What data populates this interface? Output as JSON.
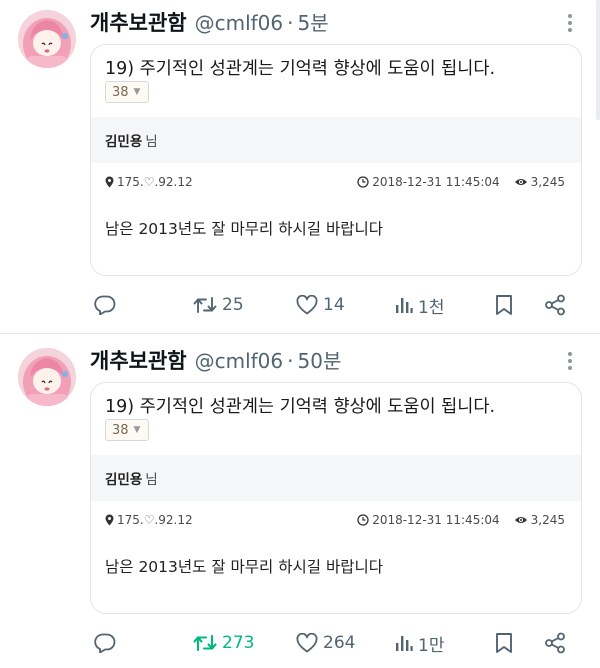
{
  "tweets": [
    {
      "author_name": "개추보관함",
      "handle": "@cmlf06",
      "separator": "·",
      "time": "5분",
      "card": {
        "title": "19) 주기적인 성관계는 기억력 향상에 도움이 됩니다.",
        "select_value": "38",
        "post_author": "김민용",
        "post_author_suffix": "님",
        "ip": "175.♡.92.12",
        "datetime": "2018-12-31 11:45:04",
        "views": "3,245",
        "body": "남은 2013년도 잘 마무리 하시길 바랍니다"
      },
      "actions": {
        "retweets": "25",
        "likes": "14",
        "views": "1천"
      },
      "retweeted": false
    },
    {
      "author_name": "개추보관함",
      "handle": "@cmlf06",
      "separator": "·",
      "time": "50분",
      "card": {
        "title": "19) 주기적인 성관계는 기억력 향상에 도움이 됩니다.",
        "select_value": "38",
        "post_author": "김민용",
        "post_author_suffix": "님",
        "ip": "175.♡.92.12",
        "datetime": "2018-12-31 11:45:04",
        "views": "3,245",
        "body": "남은 2013년도 잘 마무리 하시길 바랍니다"
      },
      "actions": {
        "retweets": "273",
        "likes": "264",
        "views": "1만"
      },
      "retweeted": true
    }
  ],
  "colors": {
    "muted": "#536471",
    "retweet_active": "#00ba7c",
    "card_border": "#e3e6ea",
    "author_bar": "#f5f6f7"
  },
  "icons": [
    "avatar",
    "more-icon",
    "location-icon",
    "clock-icon",
    "eye-icon",
    "reply-icon",
    "retweet-icon",
    "like-icon",
    "views-icon",
    "bookmark-icon",
    "share-icon"
  ]
}
